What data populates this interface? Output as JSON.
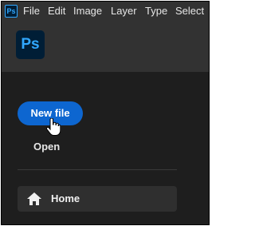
{
  "app": {
    "icon_label": "Ps"
  },
  "menubar": {
    "items": [
      "File",
      "Edit",
      "Image",
      "Layer",
      "Type",
      "Select"
    ]
  },
  "home_screen": {
    "new_file_label": "New file",
    "open_label": "Open",
    "home_label": "Home"
  },
  "colors": {
    "accent": "#0d66d0",
    "ps_blue": "#31a8ff",
    "ps_navy": "#001e36"
  },
  "icons": {
    "cursor": "hand-pointer-icon",
    "home": "home-icon"
  }
}
